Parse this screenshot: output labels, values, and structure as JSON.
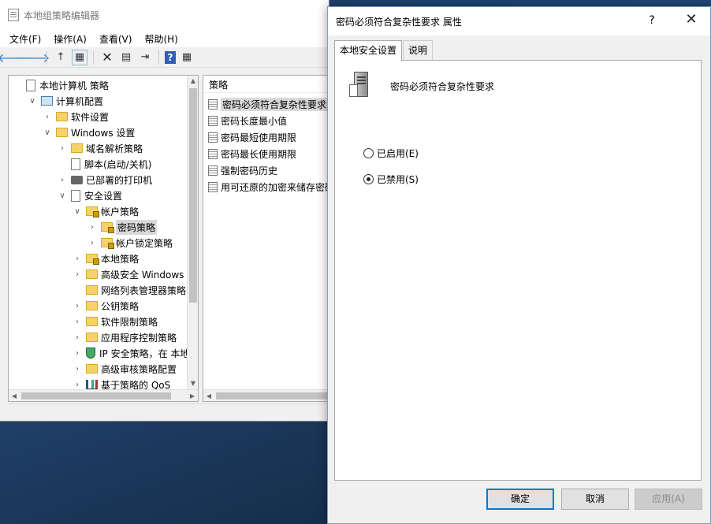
{
  "editor": {
    "title": "本地组策略编辑器",
    "menu": [
      "文件(F)",
      "操作(A)",
      "查看(V)",
      "帮助(H)"
    ],
    "toolbar": {
      "back": "🡐",
      "forward": "🡒",
      "up": "↑",
      "show_tree": "▦",
      "delete": "✕",
      "properties": "▤",
      "export": "⇥",
      "help": "?",
      "filter": "▦"
    },
    "tree": [
      {
        "label": "本地计算机 策略",
        "icon": "policy-icon",
        "chevron": ""
      },
      {
        "label": "计算机配置",
        "icon": "computer-icon",
        "chevron": "∨"
      },
      {
        "label": "软件设置",
        "icon": "folder-icon",
        "chevron": "›"
      },
      {
        "label": "Windows 设置",
        "icon": "folder-icon",
        "chevron": "∨"
      },
      {
        "label": "域名解析策略",
        "icon": "folder-icon",
        "chevron": "›"
      },
      {
        "label": "脚本(启动/关机)",
        "icon": "script-icon",
        "chevron": ""
      },
      {
        "label": "已部署的打印机",
        "icon": "printer-icon",
        "chevron": "›"
      },
      {
        "label": "安全设置",
        "icon": "security-icon",
        "chevron": "∨"
      },
      {
        "label": "帐户策略",
        "icon": "lock-folder-icon",
        "chevron": "∨"
      },
      {
        "label": "密码策略",
        "icon": "lock-folder-icon",
        "chevron": "›"
      },
      {
        "label": "帐户锁定策略",
        "icon": "lock-folder-icon",
        "chevron": "›"
      },
      {
        "label": "本地策略",
        "icon": "lock-folder-icon",
        "chevron": "›"
      },
      {
        "label": "高级安全 Windows 防火墙",
        "icon": "folder-icon",
        "chevron": "›"
      },
      {
        "label": "网络列表管理器策略",
        "icon": "folder-icon",
        "chevron": ""
      },
      {
        "label": "公钥策略",
        "icon": "folder-icon",
        "chevron": "›"
      },
      {
        "label": "软件限制策略",
        "icon": "folder-icon",
        "chevron": "›"
      },
      {
        "label": "应用程序控制策略",
        "icon": "folder-icon",
        "chevron": "›"
      },
      {
        "label": "IP 安全策略，在 本地计算机",
        "icon": "shield-icon",
        "chevron": "›"
      },
      {
        "label": "高级审核策略配置",
        "icon": "folder-icon",
        "chevron": "›"
      },
      {
        "label": "基于策略的 QoS",
        "icon": "chart-icon",
        "chevron": "›"
      }
    ],
    "list_header": "策略",
    "policies": [
      "密码必须符合复杂性要求",
      "密码长度最小值",
      "密码最短使用期限",
      "密码最长使用期限",
      "强制密码历史",
      "用可还原的加密来储存密码"
    ]
  },
  "dialog": {
    "title": "密码必须符合复杂性要求 属性",
    "help": "?",
    "close": "✕",
    "tabs": [
      "本地安全设置",
      "说明"
    ],
    "policy_name": "密码必须符合复杂性要求",
    "options": [
      {
        "label": "已启用(E)",
        "checked": false
      },
      {
        "label": "已禁用(S)",
        "checked": true
      }
    ],
    "buttons": {
      "ok": "确定",
      "cancel": "取消",
      "apply": "应用(A)"
    }
  },
  "colors": {
    "accent": "#0078d7",
    "selection": "#d9d9d9",
    "desktop": "#244a7a"
  }
}
